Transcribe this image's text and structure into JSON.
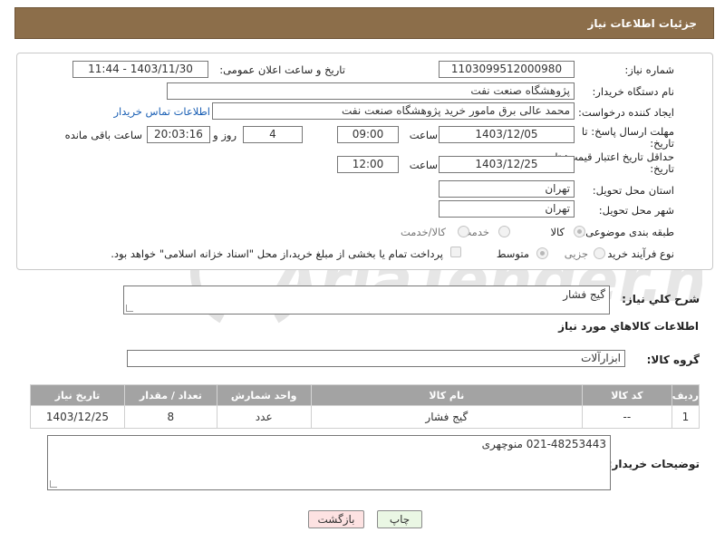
{
  "header": {
    "title": "جزئیات اطلاعات نیاز"
  },
  "form": {
    "need_number_label": "شماره نیاز:",
    "need_number": "1103099512000980",
    "announce_label": "تاریخ و ساعت اعلان عمومی:",
    "announce_value": "1403/11/30 - 11:44",
    "buyer_org_label": "نام دستگاه خریدار:",
    "buyer_org": "پژوهشگاه صنعت نفت",
    "creator_label": "ایجاد کننده درخواست:",
    "creator": "محمد عالی برق مامور خرید پژوهشگاه صنعت نفت",
    "contact_link": "اطلاعات تماس خریدار",
    "reply_deadline_label_1": "مهلت ارسال پاسخ: تا",
    "reply_deadline_label_2": "تاریخ:",
    "reply_date": "1403/12/05",
    "time_label": "ساعت",
    "reply_time": "09:00",
    "days_value": "4",
    "days_label": "روز و",
    "remaining_time": "20:03:16",
    "remaining_label": "ساعت باقی مانده",
    "price_validity_label_1": "حداقل تاریخ اعتبار قیمت: تا",
    "price_validity_label_2": "تاریخ:",
    "price_date": "1403/12/25",
    "price_time": "12:00",
    "province_label": "استان محل تحویل:",
    "province": "تهران",
    "city_label": "شهر محل تحویل:",
    "city": "تهران",
    "category_label": "طبقه بندی موضوعی:",
    "category_options": [
      "کالا",
      "خدمت",
      "کالا/خدمت"
    ],
    "category_selected": "کالا",
    "process_label": "نوع فرآیند خرید :",
    "process_options": [
      "جزیی",
      "متوسط"
    ],
    "process_selected": "متوسط",
    "payment_note": "پرداخت تمام یا بخشی از مبلغ خرید،از محل \"اسناد خزانه اسلامی\" خواهد بود."
  },
  "summary": {
    "label": "شرح کلي نياز:",
    "value": "گیج فشار",
    "goods_info_title": "اطلاعات کالاهاي مورد نياز",
    "group_label": "گروه کالا:",
    "group_value": "ابزارآلات"
  },
  "table": {
    "headers": [
      "ردیف",
      "کد کالا",
      "نام کالا",
      "واحد شمارش",
      "تعداد / مقدار",
      "تاریخ نیاز"
    ],
    "rows": [
      [
        "1",
        "--",
        "گیج فشار",
        "عدد",
        "8",
        "1403/12/25"
      ]
    ]
  },
  "buyer_notes": {
    "label": "توضیحات خریدار:",
    "value": "021-48253443 منوچهری"
  },
  "buttons": {
    "print": "چاپ",
    "back": "بازگشت"
  },
  "watermark": {
    "text": "AriaTender.net"
  },
  "colors": {
    "header_bg": "#8c6e4a",
    "table_header_bg": "#a3a3a3",
    "link": "#1a5fb4",
    "back_button_bg": "#fde2e2",
    "print_button_bg": "#eaf7e4"
  }
}
